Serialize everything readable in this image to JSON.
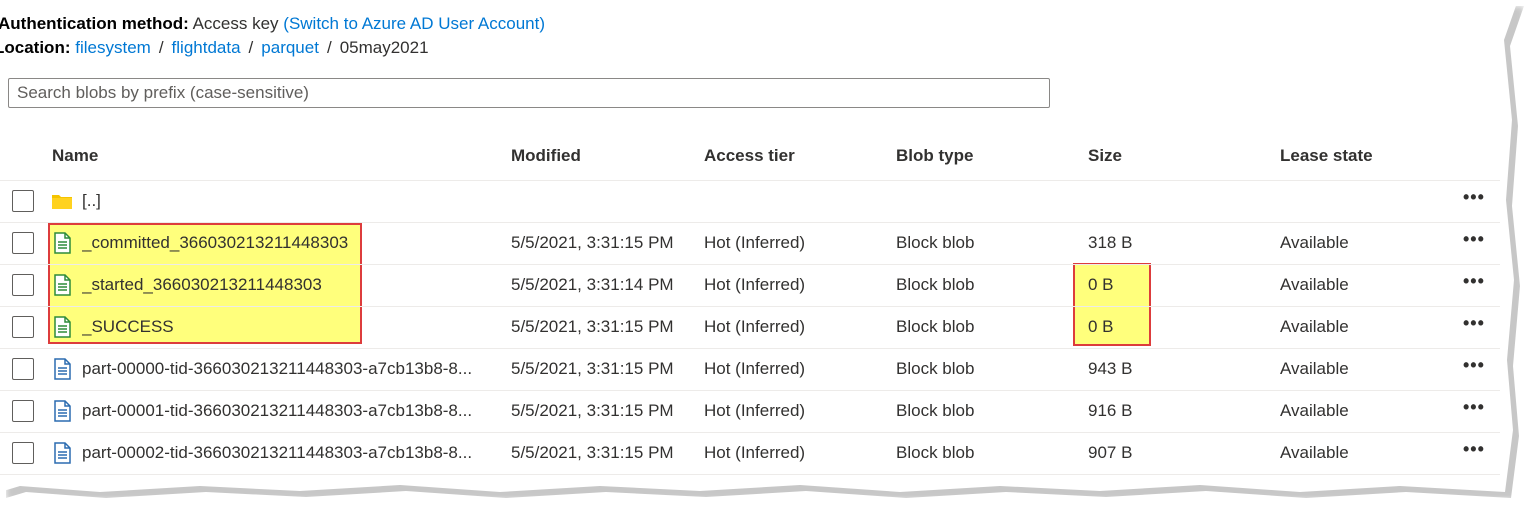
{
  "auth": {
    "label": "Authentication method:",
    "value": "Access key",
    "switch_link": "(Switch to Azure AD User Account)"
  },
  "location": {
    "label": "Location:",
    "crumbs": [
      "filesystem",
      "flightdata",
      "parquet"
    ],
    "current": "05may2021"
  },
  "search": {
    "placeholder": "Search blobs by prefix (case-sensitive)",
    "value": ""
  },
  "columns": {
    "name": "Name",
    "modified": "Modified",
    "access_tier": "Access tier",
    "blob_type": "Blob type",
    "size": "Size",
    "lease_state": "Lease state"
  },
  "parent_row": {
    "name": "[..]",
    "icon": "folder-icon"
  },
  "rows": [
    {
      "name": "_committed_366030213211448303",
      "modified": "5/5/2021, 3:31:15 PM",
      "tier": "Hot (Inferred)",
      "type": "Block blob",
      "size": "318 B",
      "lease": "Available",
      "icon": "file-green-icon"
    },
    {
      "name": "_started_366030213211448303",
      "modified": "5/5/2021, 3:31:14 PM",
      "tier": "Hot (Inferred)",
      "type": "Block blob",
      "size": "0 B",
      "lease": "Available",
      "icon": "file-green-icon"
    },
    {
      "name": "_SUCCESS",
      "modified": "5/5/2021, 3:31:15 PM",
      "tier": "Hot (Inferred)",
      "type": "Block blob",
      "size": "0 B",
      "lease": "Available",
      "icon": "file-green-icon"
    },
    {
      "name": "part-00000-tid-366030213211448303-a7cb13b8-8...",
      "modified": "5/5/2021, 3:31:15 PM",
      "tier": "Hot (Inferred)",
      "type": "Block blob",
      "size": "943 B",
      "lease": "Available",
      "icon": "file-blue-icon"
    },
    {
      "name": "part-00001-tid-366030213211448303-a7cb13b8-8...",
      "modified": "5/5/2021, 3:31:15 PM",
      "tier": "Hot (Inferred)",
      "type": "Block blob",
      "size": "916 B",
      "lease": "Available",
      "icon": "file-blue-icon"
    },
    {
      "name": "part-00002-tid-366030213211448303-a7cb13b8-8...",
      "modified": "5/5/2021, 3:31:15 PM",
      "tier": "Hot (Inferred)",
      "type": "Block blob",
      "size": "907 B",
      "lease": "Available",
      "icon": "file-blue-icon"
    }
  ],
  "more_label": "•••",
  "colors": {
    "link": "#0078d4",
    "highlight": "#ffff66",
    "highlight_border": "#d81b1b",
    "file_green": "#2e8b3a",
    "file_blue": "#2b6cb0",
    "folder": "#f5c400"
  }
}
